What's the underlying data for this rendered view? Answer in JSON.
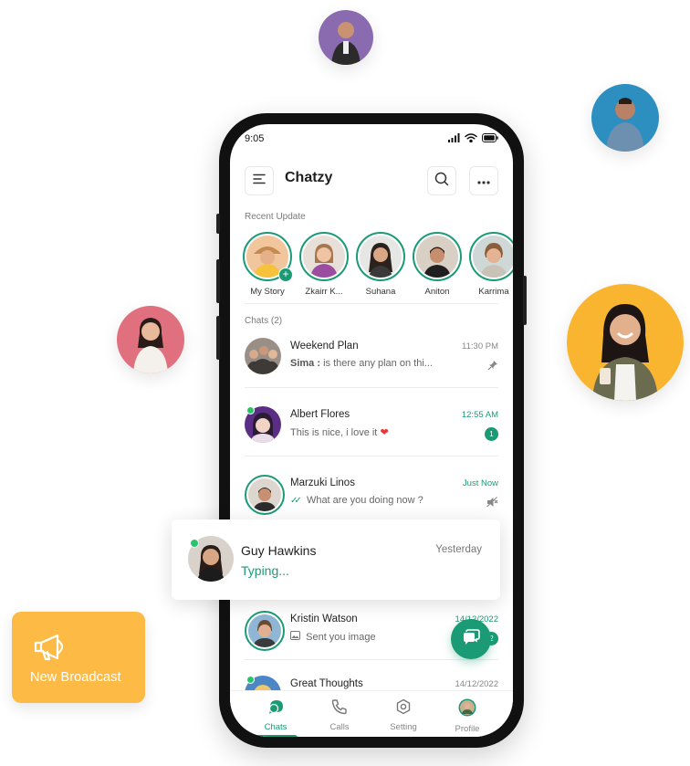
{
  "colors": {
    "primary": "#1a9b76",
    "broadcast_bg": "#fdbb46",
    "online": "#27c46b"
  },
  "broadcast": {
    "label": "New Broadcast",
    "icon": "megaphone-icon"
  },
  "status_bar": {
    "time": "9:05"
  },
  "header": {
    "title": "Chatzy",
    "menu_icon": "menu-icon",
    "search_icon": "search-icon",
    "more_icon": "more-icon"
  },
  "recent": {
    "label": "Recent Update",
    "stories": [
      {
        "name": "My Story"
      },
      {
        "name": "Zkairr K..."
      },
      {
        "name": "Suhana"
      },
      {
        "name": "Aniton"
      },
      {
        "name": "Karrima"
      }
    ]
  },
  "chats": {
    "label": "Chats (2)",
    "items": [
      {
        "name": "Weekend Plan",
        "sender": "Sima :",
        "message": "is there any plan on thi...",
        "time": "11:30 PM"
      },
      {
        "name": "Albert Flores",
        "message": "This is nice, i love it",
        "time": "12:55 AM",
        "unread": "1"
      },
      {
        "name": "Marzuki Linos",
        "message": "What are you doing now ?",
        "time": "Just Now"
      },
      {
        "name": "Kristin Watson",
        "message": "Sent you image",
        "time": "14/12/2022",
        "unread": "2"
      },
      {
        "name": "Great Thoughts",
        "time": "14/12/2022"
      }
    ]
  },
  "typing_card": {
    "name": "Guy Hawkins",
    "status": "Typing...",
    "time": "Yesterday"
  },
  "nav": {
    "items": [
      {
        "label": "Chats"
      },
      {
        "label": "Calls"
      },
      {
        "label": "Setting"
      },
      {
        "label": "Profile"
      }
    ]
  }
}
